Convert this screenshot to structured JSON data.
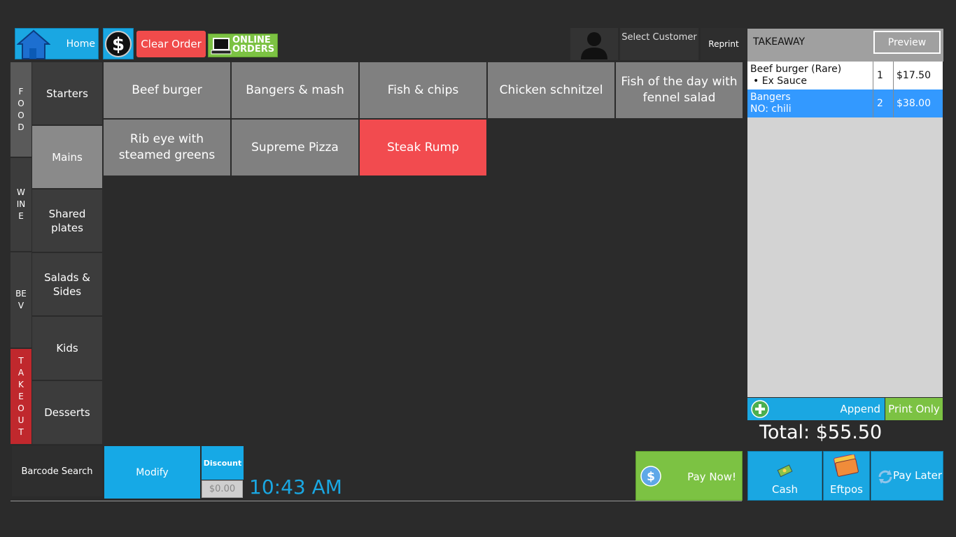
{
  "toolbar": {
    "home_label": "Home",
    "clear_order_label": "Clear Order",
    "online_orders_line1": "ONLINE",
    "online_orders_line2": "ORDERS",
    "select_customer_label": "Select Customer",
    "reprint_label": "Reprint"
  },
  "side_tabs": [
    {
      "label": "F O O D",
      "lines": [
        "F",
        "O",
        "O",
        "D"
      ]
    },
    {
      "label": "WINE",
      "lines": [
        "W",
        "IN",
        "E"
      ]
    },
    {
      "label": "BEV",
      "lines": [
        "BE",
        "V"
      ]
    },
    {
      "label": "TAKEOUT",
      "lines": [
        "T",
        "A",
        "K",
        "E",
        "O",
        "U",
        "T"
      ]
    }
  ],
  "categories": [
    {
      "label": "Starters",
      "selected": false
    },
    {
      "label": "Mains",
      "selected": true
    },
    {
      "label": "Shared plates",
      "selected": false
    },
    {
      "label": "Salads & Sides",
      "selected": false
    },
    {
      "label": "Kids",
      "selected": false
    },
    {
      "label": "Desserts",
      "selected": false
    }
  ],
  "menu_items": [
    {
      "label": "Beef burger",
      "highlighted": false
    },
    {
      "label": "Bangers & mash",
      "highlighted": false
    },
    {
      "label": "Fish & chips",
      "highlighted": false
    },
    {
      "label": "Chicken schnitzel",
      "highlighted": false
    },
    {
      "label": "Fish of the day with fennel salad",
      "highlighted": false
    },
    {
      "label": "Rib eye with steamed greens",
      "highlighted": false
    },
    {
      "label": "Supreme Pizza",
      "highlighted": false
    },
    {
      "label": "Steak Rump",
      "highlighted": true
    }
  ],
  "bottom": {
    "barcode_label": "Barcode Search",
    "modify_label": "Modify",
    "discount_label": "Discount",
    "discount_value": "$0.00",
    "time": "10:43 AM"
  },
  "order": {
    "type": "TAKEAWAY",
    "preview_label": "Preview",
    "rows": [
      {
        "name": "Beef burger (Rare)",
        "detail": "• Ex Sauce",
        "qty": "1",
        "price": "$17.50",
        "selected": false
      },
      {
        "name": "Bangers",
        "detail": "NO: chili",
        "qty": "2",
        "price": "$38.00",
        "selected": true
      }
    ],
    "append_label": "Append",
    "print_only_label": "Print Only",
    "total": "Total: $55.50"
  },
  "payment": {
    "pay_now_label": "Pay Now!",
    "cash_label": "Cash",
    "eftpos_label": "Eftpos",
    "pay_later_label": "Pay Later"
  },
  "colors": {
    "accent_blue": "#1aa7e2",
    "green": "#7cc243",
    "red": "#f04b4b",
    "selected_row": "#3399ff"
  }
}
